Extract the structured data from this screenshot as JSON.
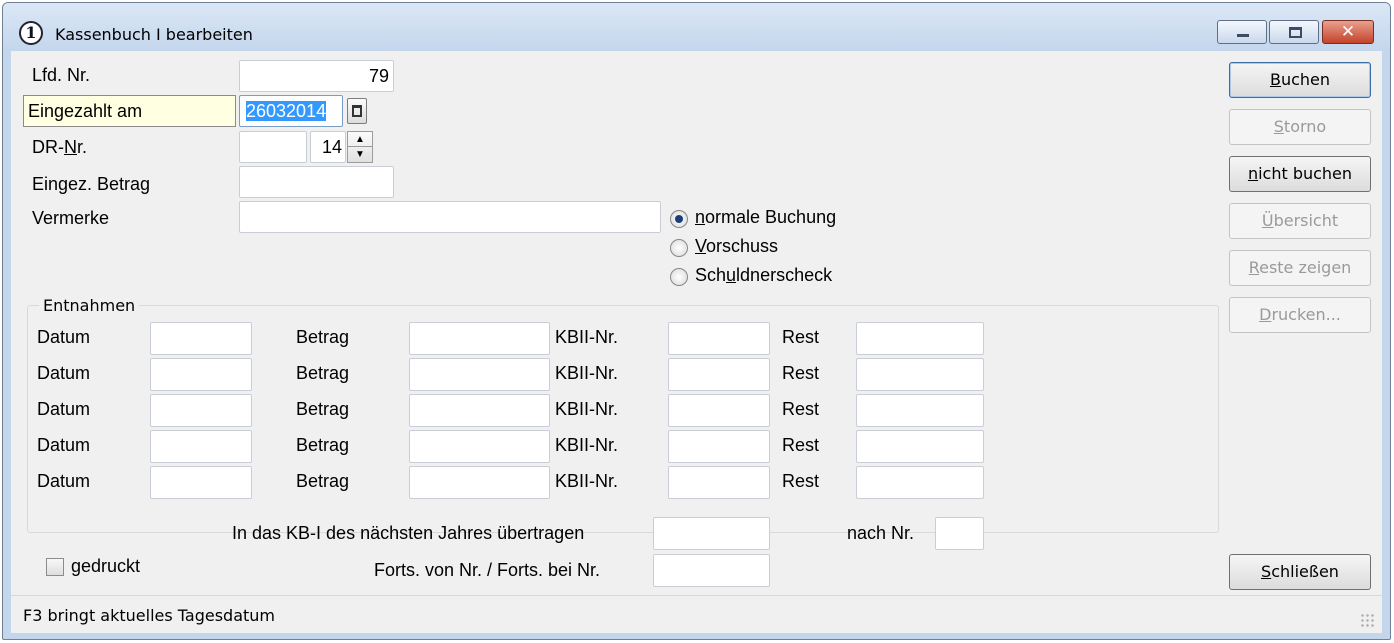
{
  "window": {
    "title": "Kassenbuch I bearbeiten",
    "app_icon_glyph": "1",
    "close_glyph": "✕"
  },
  "form": {
    "lfd_nr": {
      "label": "Lfd. Nr.",
      "value": "79"
    },
    "eingezahlt_am": {
      "label": "Eingezahlt am",
      "value": "26032014"
    },
    "dr_nr": {
      "label_pre": "DR-",
      "label_ul": "N",
      "label_post": "r.",
      "value_left": "",
      "value_right": "14"
    },
    "betrag": {
      "label": "Eingez. Betrag",
      "value": ""
    },
    "vermerke": {
      "label": "Vermerke",
      "value": ""
    }
  },
  "booking_type": {
    "selected": "normale Buchung",
    "options": [
      {
        "pre": "",
        "ul": "n",
        "post": "ormale Buchung"
      },
      {
        "pre": "",
        "ul": "V",
        "post": "orschuss"
      },
      {
        "pre": "Sch",
        "ul": "u",
        "post": "ldnerscheck"
      }
    ]
  },
  "entnahmen": {
    "legend": "Entnahmen",
    "labels": {
      "datum": "Datum",
      "betrag": "Betrag",
      "kbii": "KBII-Nr.",
      "rest": "Rest"
    },
    "rows": [
      {
        "datum": "",
        "betrag": "",
        "kbii": "",
        "rest": ""
      },
      {
        "datum": "",
        "betrag": "",
        "kbii": "",
        "rest": ""
      },
      {
        "datum": "",
        "betrag": "",
        "kbii": "",
        "rest": ""
      },
      {
        "datum": "",
        "betrag": "",
        "kbii": "",
        "rest": ""
      },
      {
        "datum": "",
        "betrag": "",
        "kbii": "",
        "rest": ""
      }
    ]
  },
  "transfer": {
    "kb_label": "In das KB-I des nächsten Jahres übertragen",
    "kb_value": "",
    "nach_label": "nach Nr.",
    "nach_value": "",
    "forts_label": "Forts. von Nr. / Forts. bei Nr.",
    "forts_value": ""
  },
  "gedruckt": {
    "label": "gedruckt",
    "checked": false
  },
  "buttons": {
    "buchen": {
      "ul": "B",
      "post": "uchen"
    },
    "storno": {
      "ul": "S",
      "post": "torno"
    },
    "nicht_buchen": {
      "ul": "n",
      "post": "icht buchen"
    },
    "uebersicht": {
      "ul": "Ü",
      "post": "bersicht"
    },
    "reste": {
      "ul": "R",
      "post": "este zeigen"
    },
    "drucken": {
      "ul": "D",
      "post": "rucken..."
    },
    "schliessen": {
      "ul": "S",
      "post": "chließen"
    }
  },
  "status": {
    "text": "F3 bringt aktuelles Tagesdatum"
  },
  "colors": {
    "selection": "#3399ff",
    "focus_label_bg": "#ffffe1",
    "close_btn": "#c4432c"
  }
}
